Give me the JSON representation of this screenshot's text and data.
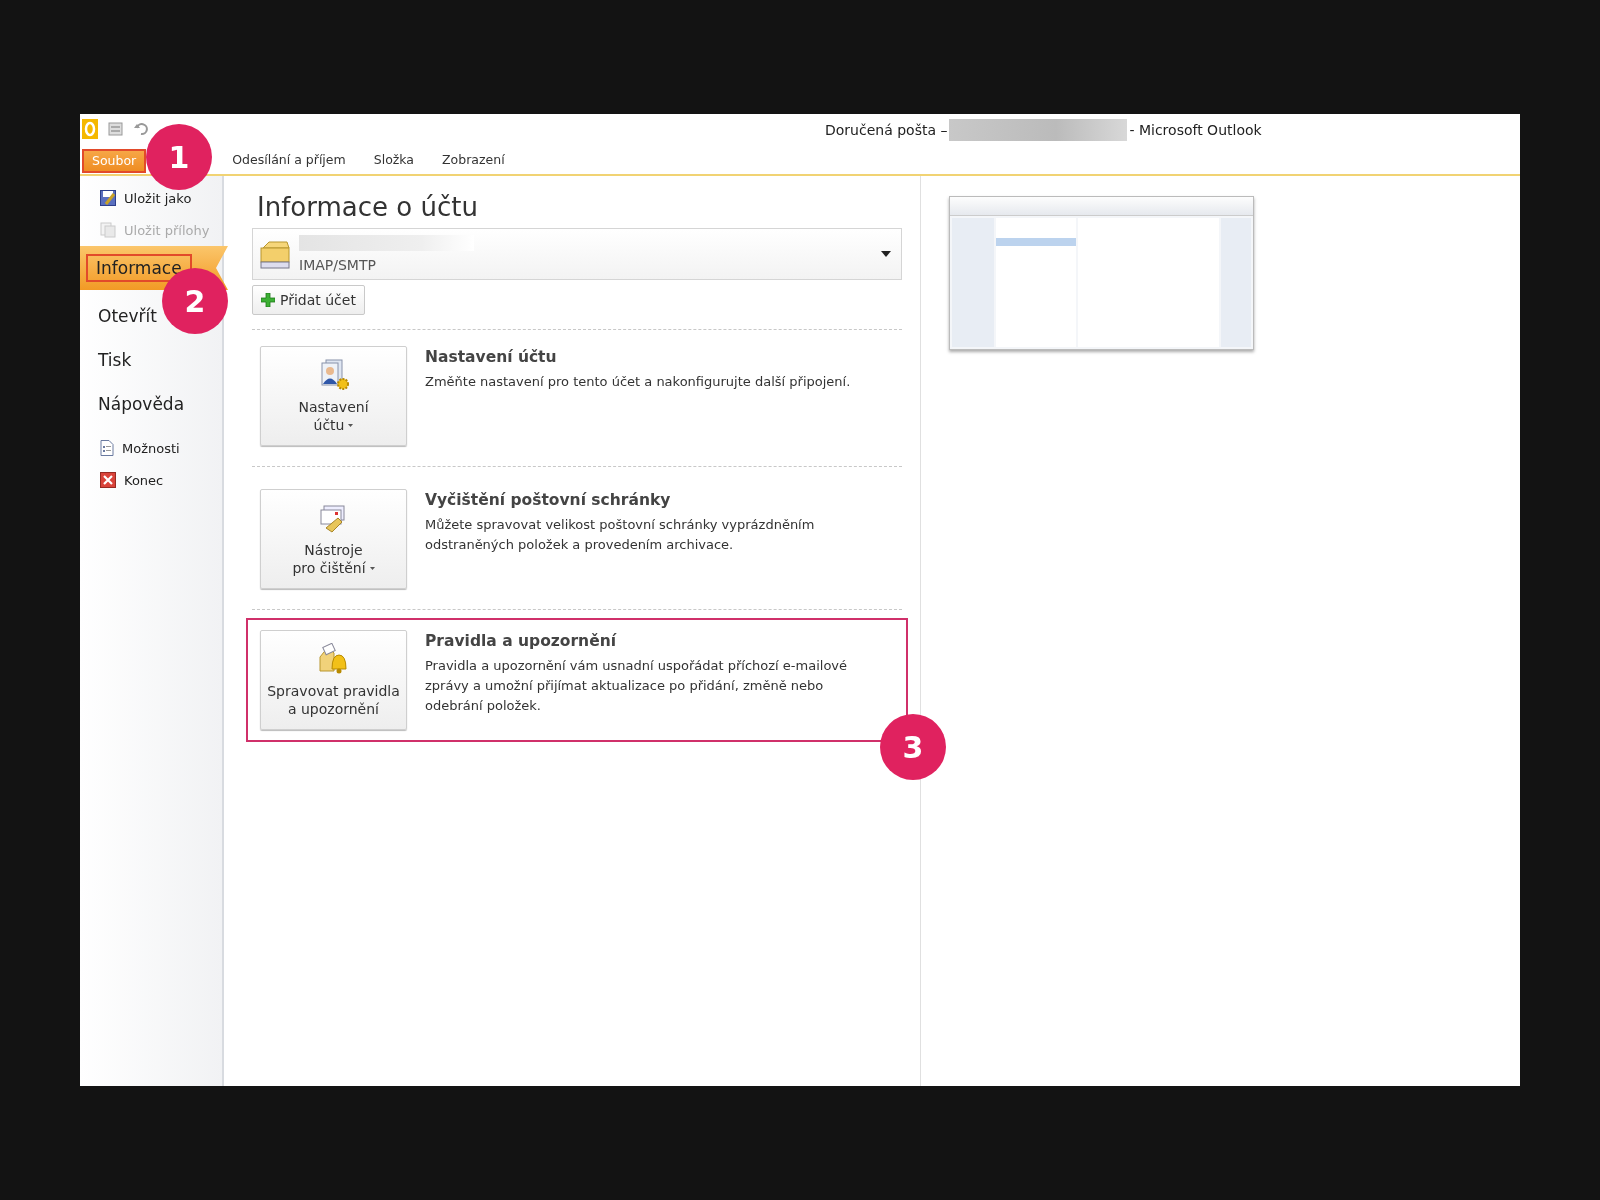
{
  "window": {
    "title_prefix": "Doručená pošta –",
    "title_suffix": "- Microsoft Outlook"
  },
  "tabs": [
    {
      "label": "Soubor",
      "selected": true,
      "highlighted": true
    },
    {
      "label": "Odesílání a příjem",
      "selected": false,
      "highlighted": false
    },
    {
      "label": "Složka",
      "selected": false,
      "highlighted": false
    },
    {
      "label": "Zobrazení",
      "selected": false,
      "highlighted": false
    }
  ],
  "sidebar": {
    "items": [
      {
        "label": "Uložit jako",
        "kind": "small",
        "disabled": false,
        "selected": false,
        "highlighted": false
      },
      {
        "label": "Uložit přílohy",
        "kind": "small",
        "disabled": true,
        "selected": false,
        "highlighted": false
      },
      {
        "label": "Informace",
        "kind": "large",
        "disabled": false,
        "selected": true,
        "highlighted": true
      },
      {
        "label": "Otevřít",
        "kind": "large",
        "disabled": false,
        "selected": false,
        "highlighted": false
      },
      {
        "label": "Tisk",
        "kind": "large",
        "disabled": false,
        "selected": false,
        "highlighted": false
      },
      {
        "label": "Nápověda",
        "kind": "large",
        "disabled": false,
        "selected": false,
        "highlighted": false
      },
      {
        "label": "Možnosti",
        "kind": "small",
        "disabled": false,
        "selected": false,
        "highlighted": false
      },
      {
        "label": "Konec",
        "kind": "small",
        "disabled": false,
        "selected": false,
        "highlighted": false
      }
    ]
  },
  "content": {
    "heading": "Informace o účtu",
    "account": {
      "type": "IMAP/SMTP"
    },
    "add_account": "Přidat účet",
    "sections": [
      {
        "button_lines": [
          "Nastavení",
          "účtu"
        ],
        "dropdown": true,
        "title": "Nastavení účtu",
        "description": "Změňte nastavení pro tento účet a nakonfigurujte další připojení.",
        "highlighted": false
      },
      {
        "button_lines": [
          "Nástroje",
          "pro čištění"
        ],
        "dropdown": true,
        "title": "Vyčištění poštovní schránky",
        "description": "Můžete spravovat velikost poštovní schránky vyprázdněním odstraněných položek a provedením archivace.",
        "highlighted": false
      },
      {
        "button_lines": [
          "Spravovat pravidla",
          "a upozornění"
        ],
        "dropdown": false,
        "title": "Pravidla a upozornění",
        "description": "Pravidla a upozornění vám usnadní uspořádat příchozí e-mailové zprávy a umožní přijímat aktualizace po přidání, změně nebo odebrání položek.",
        "highlighted": true
      }
    ]
  },
  "annotations": [
    {
      "number": "1"
    },
    {
      "number": "2"
    },
    {
      "number": "3"
    }
  ]
}
